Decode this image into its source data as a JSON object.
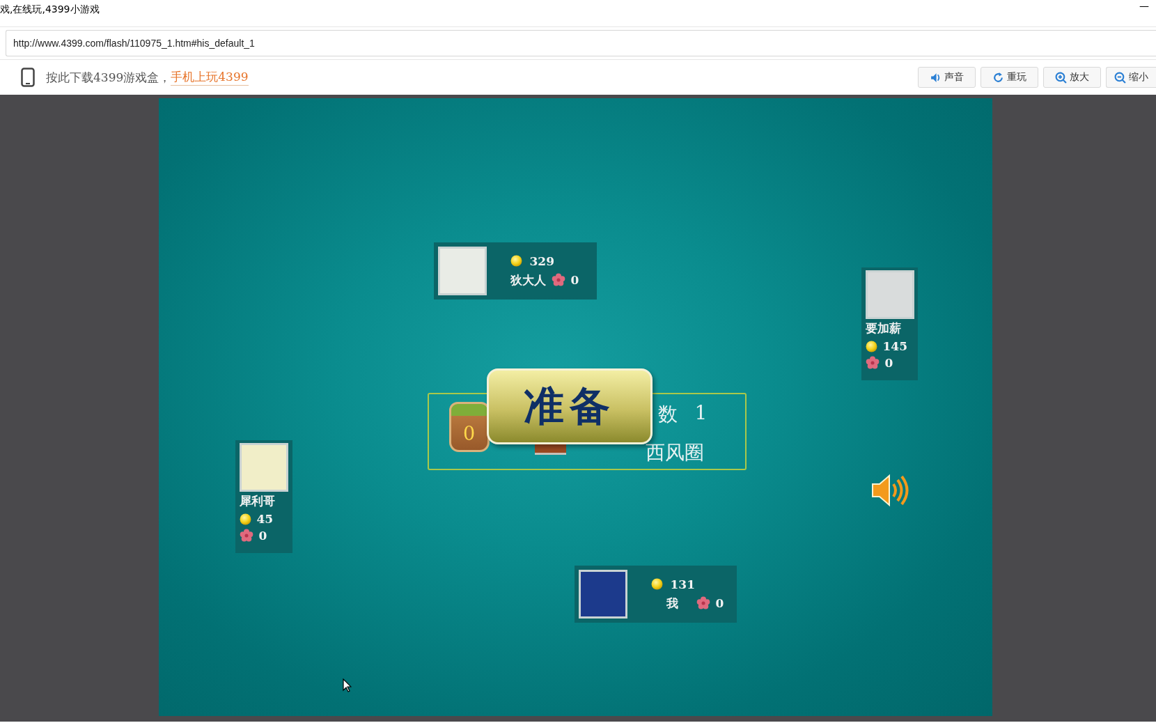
{
  "window": {
    "title": "戏,在线玩,4399小游戏",
    "minimize": "—"
  },
  "address_bar": {
    "url": "http://www.4399.com/flash/110975_1.htm#his_default_1"
  },
  "toolbar": {
    "download_text": "按此下载4399游戏盒，",
    "download_link": "手机上玩4399",
    "buttons": [
      {
        "kind": "sound",
        "label": "声音"
      },
      {
        "kind": "replay",
        "label": "重玩"
      },
      {
        "kind": "zoom_in",
        "label": "放大"
      },
      {
        "kind": "zoom_out",
        "label": "缩小"
      }
    ]
  },
  "game": {
    "players": [
      {
        "kind": "horizontal",
        "name": "狄大人",
        "coins": "329",
        "flowers": "0"
      },
      {
        "kind": "vertical",
        "name": "要加薪",
        "coins": "145",
        "flowers": "0"
      },
      {
        "kind": "vertical",
        "name": "犀利哥",
        "coins": "45",
        "flowers": "0"
      },
      {
        "kind": "horizontal",
        "name": "我",
        "coins": "131",
        "flowers": "0"
      }
    ],
    "center_panel": {
      "badge": "0",
      "count_label": "数",
      "count_value": "1",
      "wind": "西风圈"
    },
    "ready_button": "准备"
  }
}
